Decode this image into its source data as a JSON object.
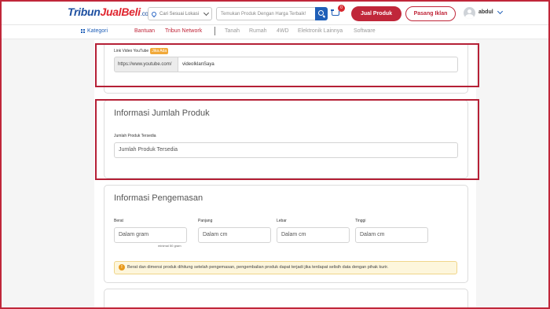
{
  "header": {
    "logo": {
      "part1": "Tribun",
      "part2": "JualBeli",
      "part3": ".com"
    },
    "location": {
      "value": "Cari Sesuai Lokasi"
    },
    "search": {
      "placeholder": "Temukan Produk Dengan Harga Terbaik!"
    },
    "cart": {
      "count": "0"
    },
    "jual_label": "Jual Produk",
    "pasang_label": "Pasang Iklan",
    "user": "abdul"
  },
  "nav": {
    "kategori": "Kategori",
    "bantuan": "Bantuan",
    "tribun_network": "Tribun Network",
    "items": [
      "Tanah",
      "Rumah",
      "4WD",
      "Elektronik Lainnya",
      "Software"
    ]
  },
  "video": {
    "label": "Link Video YouTube",
    "tag": "Jika Ada",
    "prefix": "https://www.youtube.com/",
    "value": "videoIklanSaya"
  },
  "jumlah": {
    "title": "Informasi Jumlah Produk",
    "label": "Jumlah Produk Tersedia",
    "placeholder": "Jumlah Produk Tersedia"
  },
  "pengemasan": {
    "title": "Informasi Pengemasan",
    "fields": [
      {
        "label": "Berat",
        "placeholder": "Dalam gram"
      },
      {
        "label": "Panjang",
        "placeholder": "Dalam cm"
      },
      {
        "label": "Lebar",
        "placeholder": "Dalam cm"
      },
      {
        "label": "Tinggi",
        "placeholder": "Dalam cm"
      }
    ],
    "hint": "minimal 50 gram",
    "notice": "Berat dan dimensi produk dihitung setelah pengemasan, pengembalian produk dapat terjadi jika terdapat selisih data dengan pihak kurir."
  },
  "colors": {
    "brand_red": "#c0273a",
    "brand_blue": "#1f5fb8",
    "tag_orange": "#f1a93a"
  }
}
